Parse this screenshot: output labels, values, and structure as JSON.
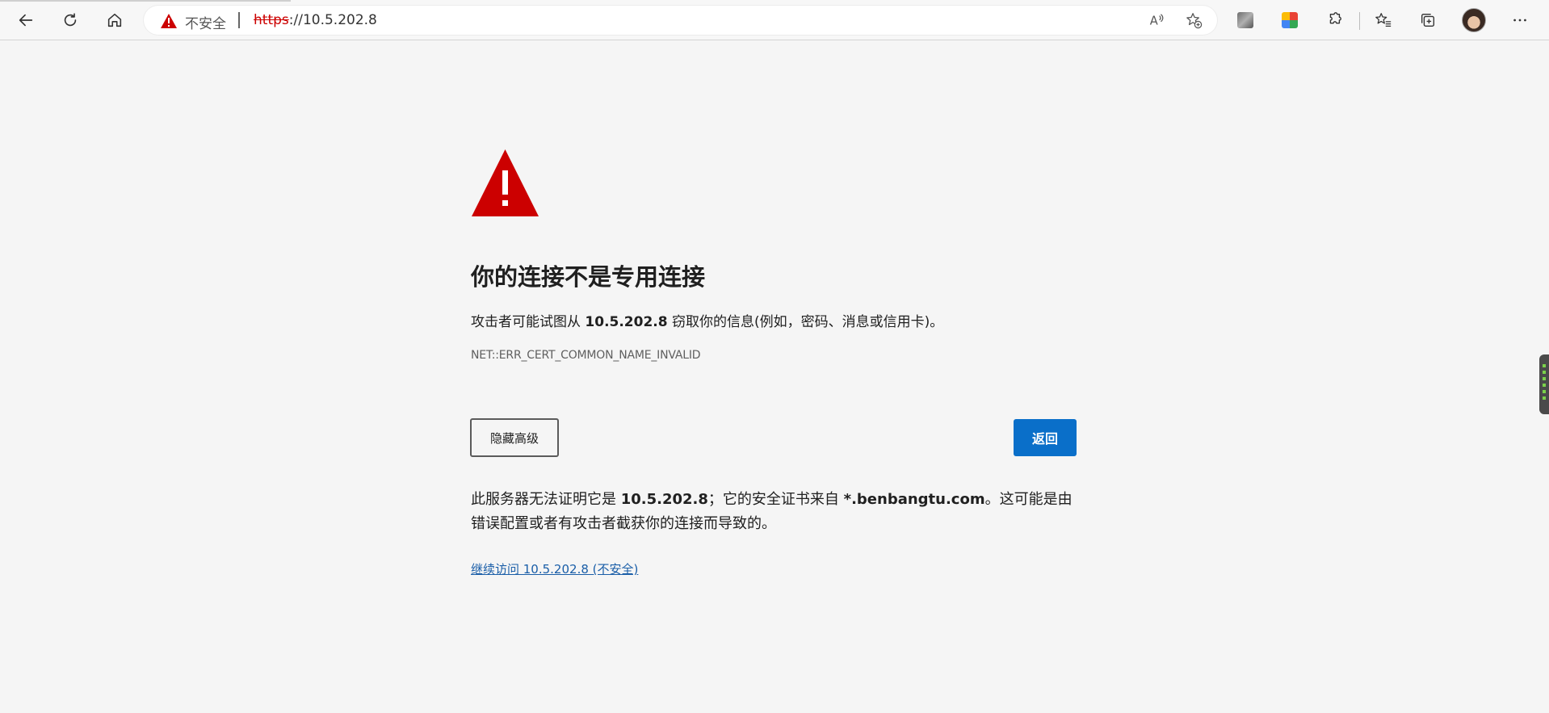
{
  "browser": {
    "address_bar": {
      "security_label": "不安全",
      "url_scheme": "https",
      "url_rest": "://10.5.202.8"
    },
    "icons": {
      "back": "back-arrow-icon",
      "refresh": "refresh-icon",
      "home": "home-icon",
      "read_aloud": "read-aloud-icon",
      "add_favorite": "add-favorite-icon",
      "extension1": "extension-icon",
      "extension2": "extension-icon",
      "extensions": "puzzle-icon",
      "favorites": "favorites-icon",
      "collections": "collections-icon",
      "profile": "avatar",
      "more": "more-icon"
    }
  },
  "error_page": {
    "heading": "你的连接不是专用连接",
    "description": {
      "before": "攻击者可能试图从 ",
      "host": "10.5.202.8",
      "after": " 窃取你的信息(例如，密码、消息或信用卡)。"
    },
    "error_code": "NET::ERR_CERT_COMMON_NAME_INVALID",
    "advanced_button": "隐藏高级",
    "back_button": "返回",
    "explanation": {
      "part1": "此服务器无法证明它是 ",
      "host": "10.5.202.8",
      "part2": "；它的安全证书来自 ",
      "cert_domain": "*.benbangtu.com",
      "part3": "。这可能是由错误配置或者有攻击者截获你的连接而导致的。"
    },
    "proceed_link": "继续访问 10.5.202.8 (不安全)"
  },
  "colors": {
    "warning_red": "#cc0000",
    "primary_blue": "#0a6fc9",
    "link_blue": "#1a5ea8",
    "page_background": "#f5f5f5"
  }
}
